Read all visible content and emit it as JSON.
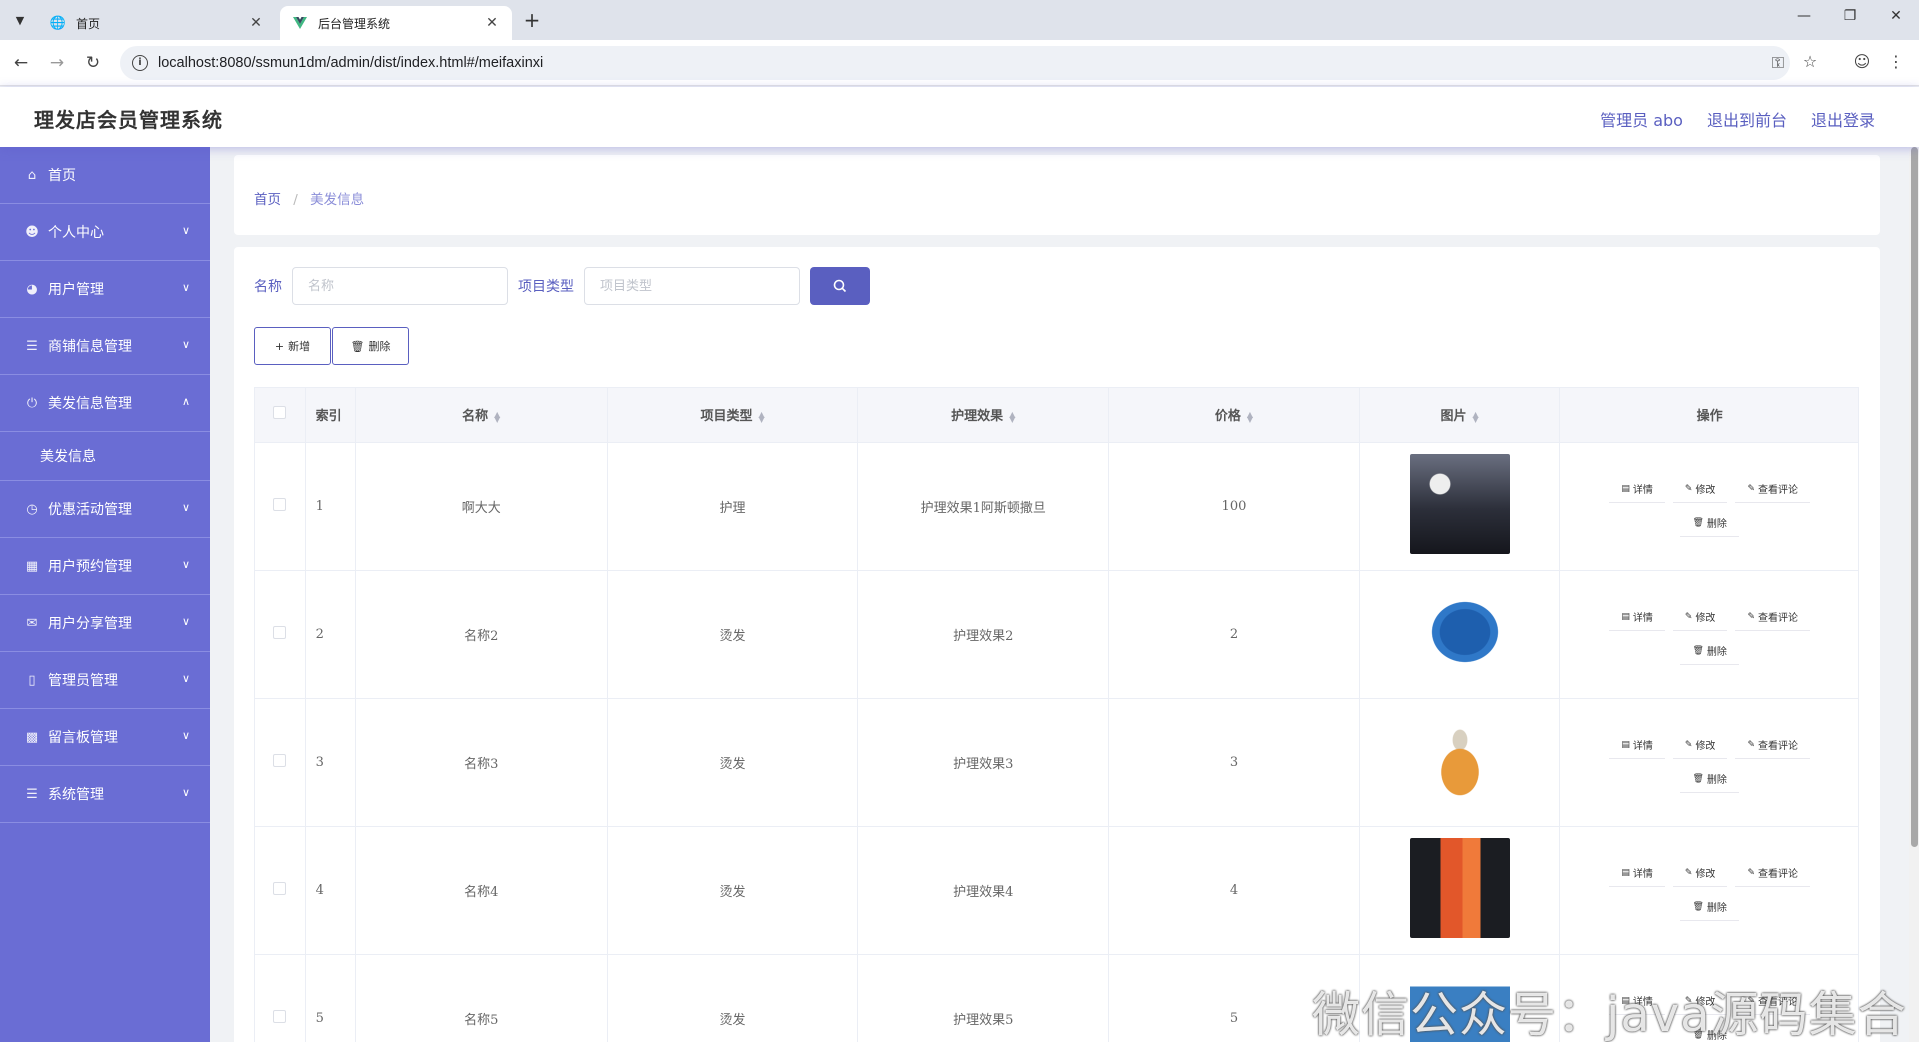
{
  "browser": {
    "tabs": [
      {
        "title": "首页",
        "favicon": "globe-icon"
      },
      {
        "title": "后台管理系统",
        "favicon": "vue-logo-icon"
      }
    ],
    "url": "localhost:8080/ssmun1dm/admin/dist/index.html#/meifaxinxi"
  },
  "header": {
    "title": "理发店会员管理系统",
    "user_label": "管理员 abo",
    "front_link": "退出到前台",
    "logout_link": "退出登录"
  },
  "sidebar": {
    "items": [
      {
        "label": "首页",
        "icon": "home-icon"
      },
      {
        "label": "个人中心",
        "icon": "user-icon"
      },
      {
        "label": "用户管理",
        "icon": "dashboard-icon"
      },
      {
        "label": "商铺信息管理",
        "icon": "list-icon"
      },
      {
        "label": "美发信息管理",
        "icon": "power-icon"
      },
      {
        "label": "美发信息",
        "icon": ""
      },
      {
        "label": "优惠活动管理",
        "icon": "clock-icon"
      },
      {
        "label": "用户预约管理",
        "icon": "chart-icon"
      },
      {
        "label": "用户分享管理",
        "icon": "mail-icon"
      },
      {
        "label": "管理员管理",
        "icon": "ticket-icon"
      },
      {
        "label": "留言板管理",
        "icon": "bars-icon"
      },
      {
        "label": "系统管理",
        "icon": "list-icon"
      }
    ]
  },
  "breadcrumb": {
    "home": "首页",
    "current": "美发信息"
  },
  "search": {
    "name_label": "名称",
    "name_placeholder": "名称",
    "type_label": "项目类型",
    "type_placeholder": "项目类型"
  },
  "actions": {
    "add": "新增",
    "delete": "删除"
  },
  "table": {
    "headers": [
      "索引",
      "名称",
      "项目类型",
      "护理效果",
      "价格",
      "图片",
      "操作"
    ],
    "ops": {
      "detail": "详情",
      "edit": "修改",
      "comments": "查看评论",
      "delete": "删除"
    },
    "rows": [
      {
        "index": "1",
        "name": "啊大大",
        "type": "护理",
        "effect": "护理效果1阿斯顿撒旦",
        "price": "100"
      },
      {
        "index": "2",
        "name": "名称2",
        "type": "烫发",
        "effect": "护理效果2",
        "price": "2"
      },
      {
        "index": "3",
        "name": "名称3",
        "type": "烫发",
        "effect": "护理效果3",
        "price": "3"
      },
      {
        "index": "4",
        "name": "名称4",
        "type": "烫发",
        "effect": "护理效果4",
        "price": "4"
      },
      {
        "index": "5",
        "name": "名称5",
        "type": "烫发",
        "effect": "护理效果5",
        "price": "5"
      }
    ]
  },
  "watermark": "微信公众号：java源码集合",
  "colors": {
    "primary": "#5a5fc0",
    "sidebar": "#6a6dd4"
  }
}
